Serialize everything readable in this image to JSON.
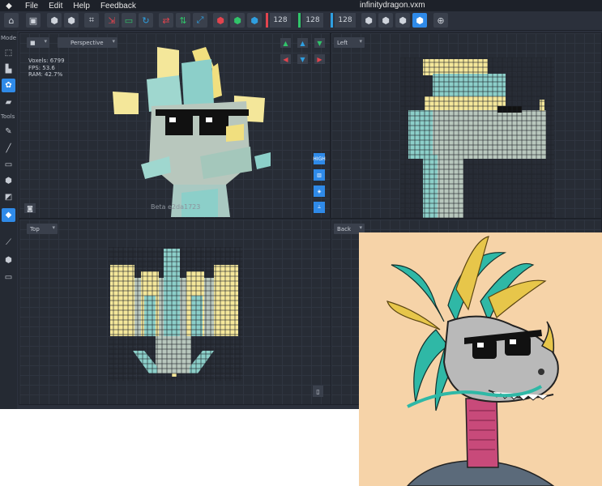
{
  "menubar": {
    "menus": [
      "File",
      "Edit",
      "Help",
      "Feedback"
    ],
    "title": "infinitydragon.vxm"
  },
  "toolbar": {
    "dim_x": "128",
    "dim_y": "128",
    "dim_z": "128",
    "colors": {
      "x_axis": "#e2444e",
      "y_axis": "#31c46a",
      "z_axis": "#2f9fe0",
      "accent": "#2f8ae8"
    }
  },
  "leftpanel": {
    "mode_label": "Mode",
    "tools_label": "Tools",
    "mode_icons": [
      "select-icon",
      "voxel-icon",
      "palette-icon",
      "eraser-icon"
    ],
    "tool_icons": [
      "pencil-icon",
      "line-icon",
      "rect-icon",
      "cube-icon",
      "extrude-icon",
      "fill-icon",
      "picker-icon",
      "box-icon",
      "display-icon"
    ]
  },
  "viewports": {
    "perspective": {
      "mode_value": "■",
      "camera": "Perspective"
    },
    "left": {
      "label": "Left"
    },
    "top": {
      "label": "Top"
    },
    "back": {
      "label": "Back"
    }
  },
  "stats": {
    "voxels": "Voxels: 6799",
    "fps": "FPS: 53.6",
    "ram": "RAM: 42.7%"
  },
  "view_buttons": [
    "HIGH",
    "▥",
    "◈",
    "⟂"
  ],
  "watermark": "Beta e2da1723"
}
